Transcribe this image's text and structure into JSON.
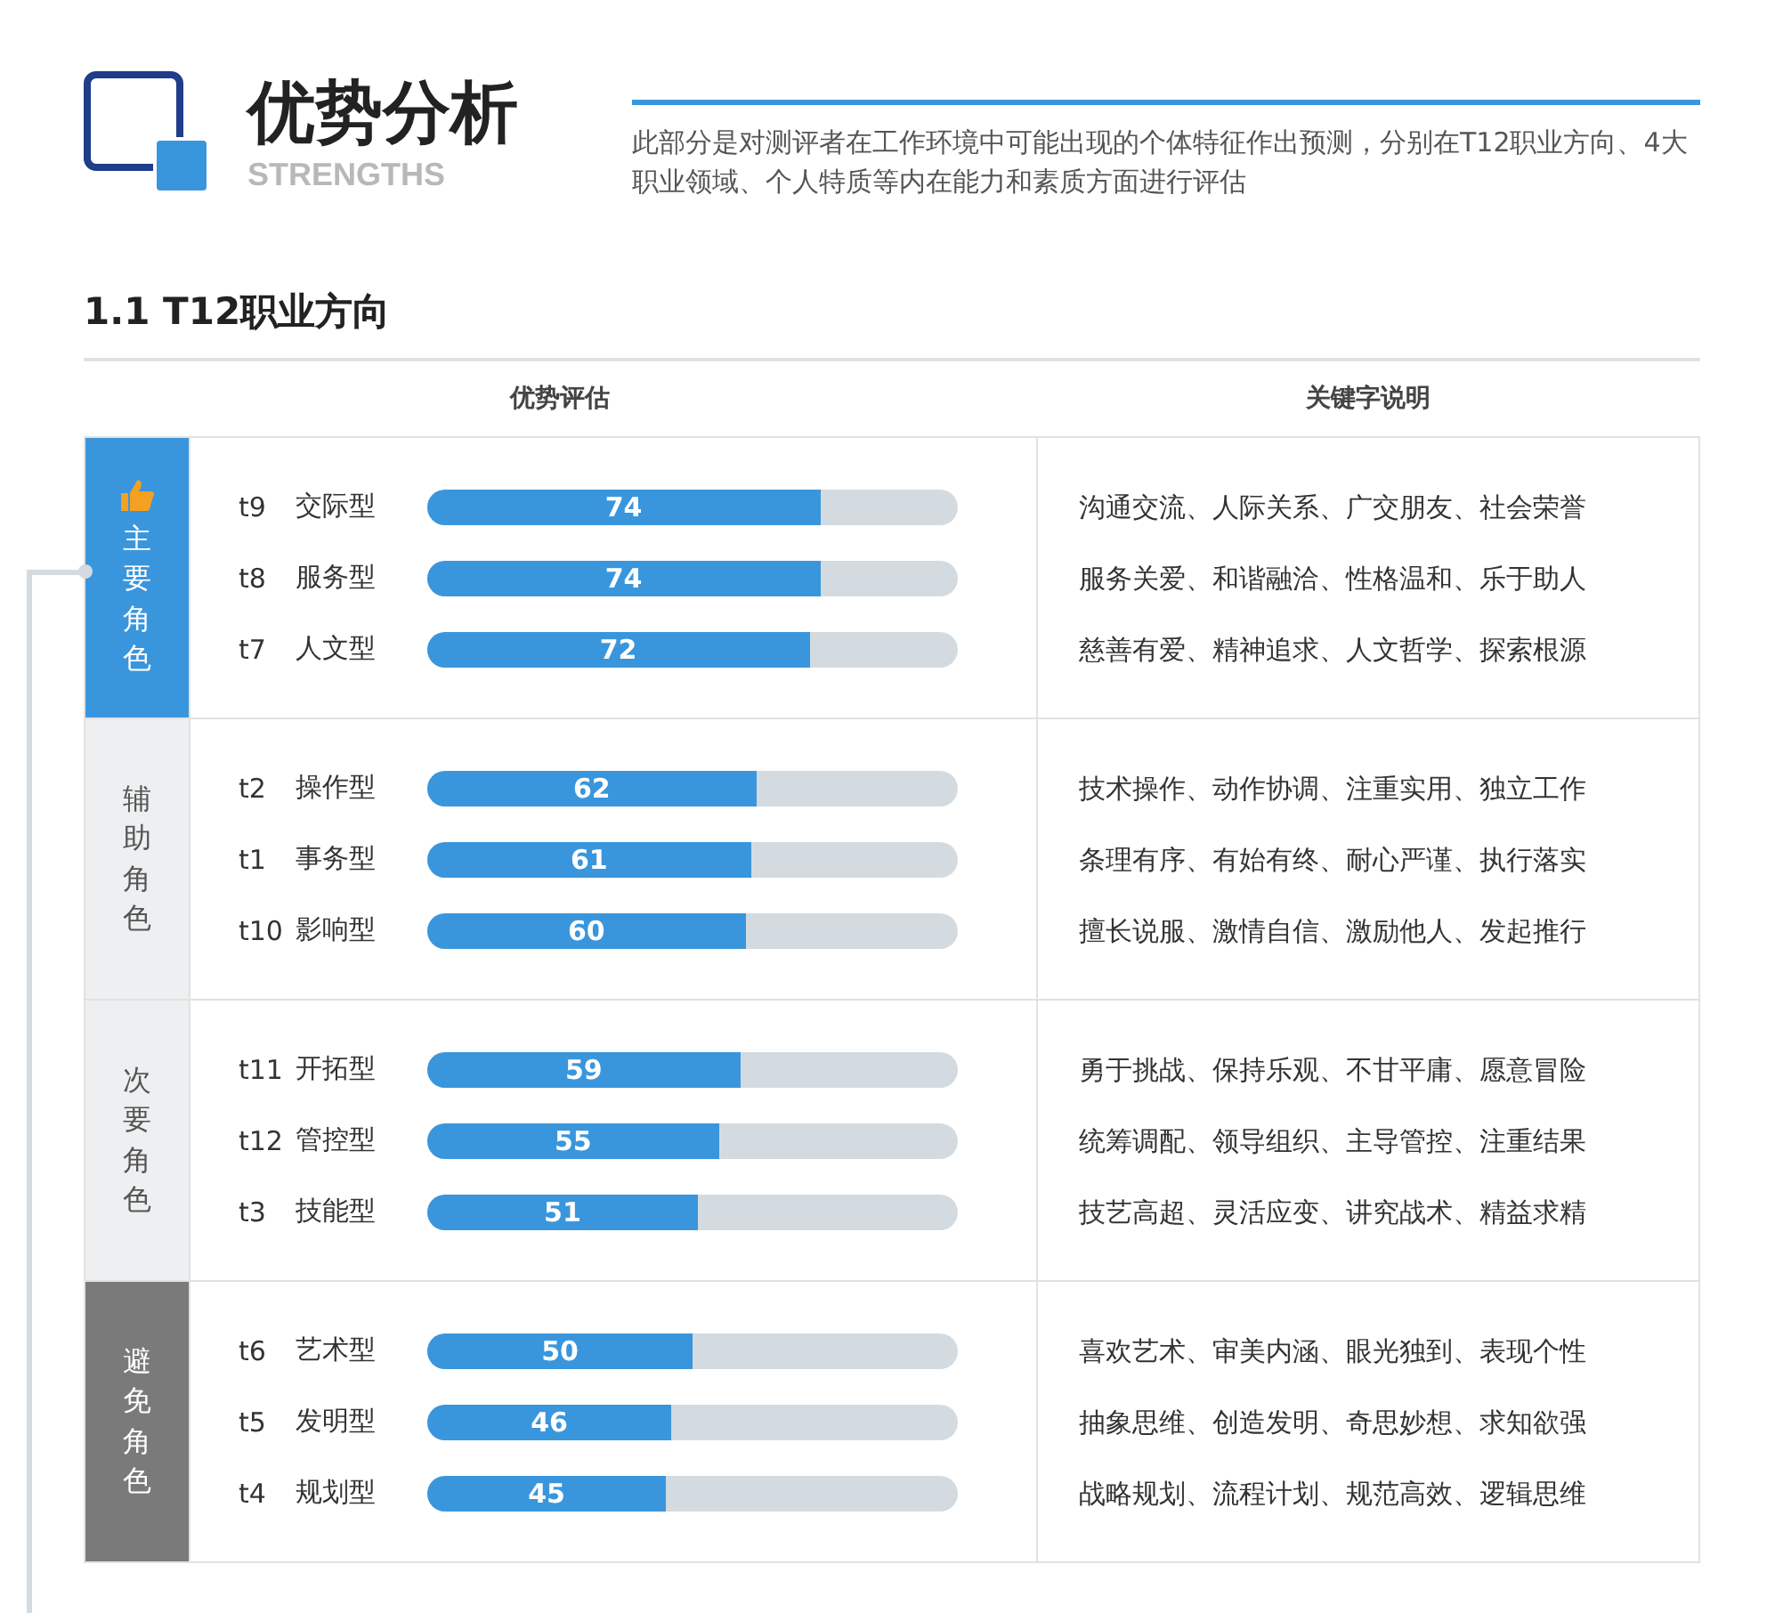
{
  "header": {
    "title": "优势分析",
    "subtitle": "STRENGTHS",
    "description": "此部分是对测评者在工作环境中可能出现的个体特征作出预测，分别在T12职业方向、4大职业领域、个人特质等内在能力和素质方面进行评估"
  },
  "section": {
    "title": "1.1 T12职业方向"
  },
  "table": {
    "columns": [
      "优势评估",
      "关键字说明"
    ],
    "groups": [
      {
        "kind": "primary",
        "label": "主要角色",
        "rows": [
          {
            "code": "t9",
            "name": "交际型",
            "score": "74",
            "level": 0.74,
            "keywords": "沟通交流、人际关系、广交朋友、社会荣誉"
          },
          {
            "code": "t8",
            "name": "服务型",
            "score": "74",
            "level": 0.74,
            "keywords": "服务关爱、和谐融洽、性格温和、乐于助人"
          },
          {
            "code": "t7",
            "name": "人文型",
            "score": "72",
            "level": 0.72,
            "keywords": "慈善有爱、精神追求、人文哲学、探索根源"
          }
        ]
      },
      {
        "kind": "secondary",
        "label": "辅助角色",
        "rows": [
          {
            "code": "t2",
            "name": "操作型",
            "score": "62",
            "level": 0.62,
            "keywords": "技术操作、动作协调、注重实用、独立工作"
          },
          {
            "code": "t1",
            "name": "事务型",
            "score": "61",
            "level": 0.61,
            "keywords": "条理有序、有始有终、耐心严谨、执行落实"
          },
          {
            "code": "t10",
            "name": "影响型",
            "score": "60",
            "level": 0.6,
            "keywords": "擅长说服、激情自信、激励他人、发起推行"
          }
        ]
      },
      {
        "kind": "secondary",
        "label": "次要角色",
        "rows": [
          {
            "code": "t11",
            "name": "开拓型",
            "score": "59",
            "level": 0.59,
            "keywords": "勇于挑战、保持乐观、不甘平庸、愿意冒险"
          },
          {
            "code": "t12",
            "name": "管控型",
            "score": "55",
            "level": 0.55,
            "keywords": "统筹调配、领导组织、主导管控、注重结果"
          },
          {
            "code": "t3",
            "name": "技能型",
            "score": "51",
            "level": 0.51,
            "keywords": "技艺高超、灵活应变、讲究战术、精益求精"
          }
        ]
      },
      {
        "kind": "avoid",
        "label": "避免角色",
        "rows": [
          {
            "code": "t6",
            "name": "艺术型",
            "score": "50",
            "level": 0.5,
            "keywords": "喜欢艺术、审美内涵、眼光独到、表现个性"
          },
          {
            "code": "t5",
            "name": "发明型",
            "score": "46",
            "level": 0.46,
            "keywords": "抽象思维、创造发明、奇思妙想、求知欲强"
          },
          {
            "code": "t4",
            "name": "规划型",
            "score": "45",
            "level": 0.45,
            "keywords": "战略规划、流程计划、规范高效、逻辑思维"
          }
        ]
      }
    ]
  }
}
